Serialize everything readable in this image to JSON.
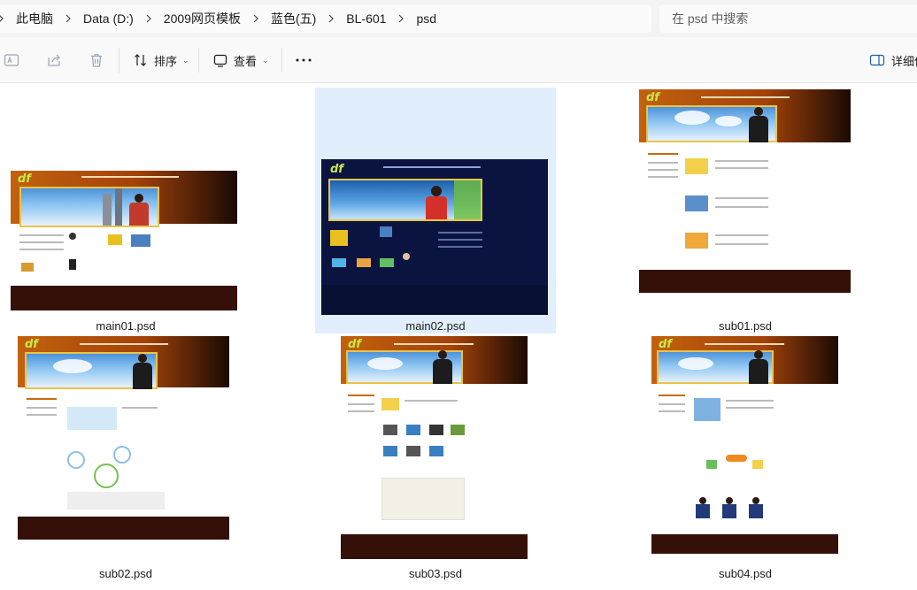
{
  "breadcrumb": {
    "items": [
      "此电脑",
      "Data (D:)",
      "2009网页模板",
      "蓝色(五)",
      "BL-601",
      "psd"
    ]
  },
  "search": {
    "placeholder": "在 psd 中搜索"
  },
  "toolbar": {
    "sort_label": "排序",
    "view_label": "查看",
    "details_label": "详细信息"
  },
  "files": [
    {
      "name": "main01.psd",
      "selected": false
    },
    {
      "name": "main02.psd",
      "selected": true
    },
    {
      "name": "sub01.psd",
      "selected": false
    },
    {
      "name": "sub02.psd",
      "selected": false
    },
    {
      "name": "sub03.psd",
      "selected": false
    },
    {
      "name": "sub04.psd",
      "selected": false
    }
  ],
  "colors": {
    "selection": "#e1effc",
    "header_orange": "#c86a10",
    "footer_brown": "#341008",
    "navy": "#0b1440"
  },
  "icons": [
    "rename-icon",
    "share-icon",
    "delete-icon",
    "sort-icon",
    "view-icon",
    "more-icon",
    "details-pane-icon",
    "chevron-right-icon"
  ]
}
